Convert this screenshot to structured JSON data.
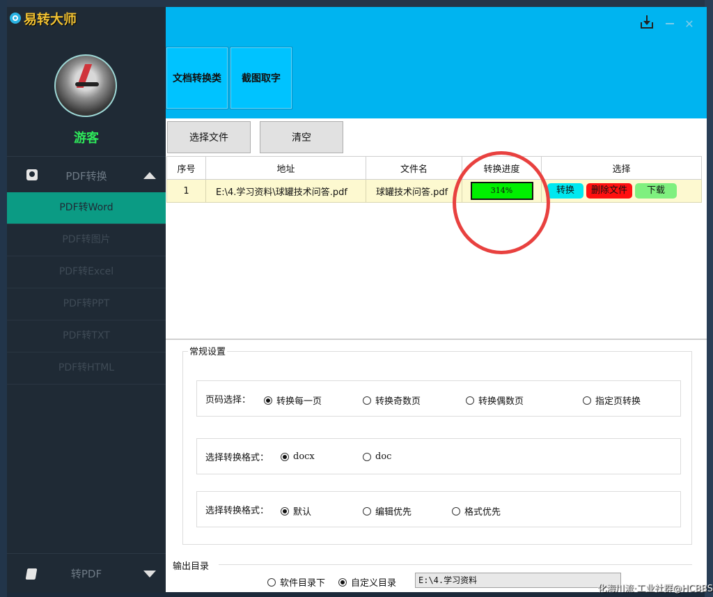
{
  "app": {
    "logo_text": "易转大师",
    "user_name": "游客"
  },
  "sidebar": {
    "section_title": "PDF转换",
    "items": [
      {
        "label": "PDF转Word",
        "active": true
      },
      {
        "label": "PDF转图片"
      },
      {
        "label": "PDF转Excel"
      },
      {
        "label": "PDF转PPT"
      },
      {
        "label": "PDF转TXT"
      },
      {
        "label": "PDF转HTML"
      }
    ],
    "footer_title": "转PDF"
  },
  "window": {
    "close_glyph": "✕"
  },
  "categories": [
    {
      "label": "文档转换类"
    },
    {
      "label": "截图取字"
    }
  ],
  "toolbar": {
    "select_file": "选择文件",
    "clear": "清空"
  },
  "table": {
    "headers": [
      "序号",
      "地址",
      "文件名",
      "转换进度",
      "选择"
    ],
    "rows": [
      {
        "index": "1",
        "path": "E:\\4.学习资料\\球罐技术问答.pdf",
        "filename": "球罐技术问答.pdf",
        "progress": "314%",
        "actions": {
          "convert": "转换",
          "delete": "删除文件",
          "download": "下载"
        }
      }
    ]
  },
  "settings": {
    "group_title": "常规设置",
    "page_select": {
      "label": "页码选择：",
      "options": [
        "转换每一页",
        "转换奇数页",
        "转换偶数页",
        "指定页转换"
      ],
      "selected": 0
    },
    "format_select": {
      "label": "选择转换格式：",
      "options": [
        "docx",
        "doc"
      ],
      "selected": 0
    },
    "priority_select": {
      "label": "选择转换格式：",
      "options": [
        "默认",
        "编辑优先",
        "格式优先"
      ],
      "selected": 0
    }
  },
  "output": {
    "title": "输出目录",
    "options": [
      "软件目录下",
      "自定义目录"
    ],
    "selected": 1,
    "path": "E:\\4.学习资料"
  },
  "overlay": {
    "watermark": "化海川流·工业社群@HCBBS"
  },
  "colors": {
    "topbar": "#00b4f0",
    "sidebar": "#1f2a35",
    "sidebar_active": "#0b9b84",
    "progress_fill": "#00f000",
    "highlight_circle": "#e8413f"
  }
}
